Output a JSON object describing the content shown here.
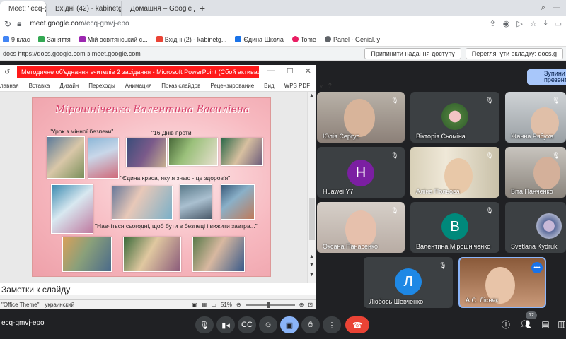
{
  "browser": {
    "tabs": [
      {
        "label": "Meet: \"ecq-gmvj",
        "color": "#00897b"
      },
      {
        "label": "Вхідні (42) - kabinetgeo",
        "color": "#ea4335"
      },
      {
        "label": "Домашня – Google Диск",
        "color": "#fbbc04"
      }
    ],
    "new_tab": "+",
    "url_host": "meet.google.com",
    "url_path": "/ecq-gmvj-epo"
  },
  "bookmarks": [
    {
      "label": "9 клас",
      "color": "#4285f4"
    },
    {
      "label": "Заняття",
      "color": "#34a853"
    },
    {
      "label": "Мій освітянський с...",
      "color": "#9c27b0"
    },
    {
      "label": "Вхідні (2) - kabinetg...",
      "color": "#ea4335"
    },
    {
      "label": "Єдина Школа",
      "color": "#1a73e8"
    },
    {
      "label": "Tome",
      "color": "#e91e63"
    },
    {
      "label": "Panel - Genial.ly",
      "color": "#5f6368"
    }
  ],
  "sharebar": {
    "text": "docs https://docs.google.com з meet.google.com",
    "stop_label": "Припинити надання доступу",
    "view_label": "Переглянути вкладку: docs.g"
  },
  "ppt": {
    "window_title": "Методичне об'єднання вчителів 2 засідання - Microsoft PowerPoint (Сбой активаци...",
    "ribbon_tabs": [
      "лавная",
      "Вставка",
      "Дизайн",
      "Переходы",
      "Анимация",
      "Показ слайдов",
      "Рецензирование",
      "Вид",
      "WPS PDF"
    ],
    "slide": {
      "title": "Мірошніченко Валентина Василівна",
      "caption1": "\"Урок з мінної безпеки\"",
      "caption2": "\"16 Днів проти",
      "caption3": "\"Єдина краса, яку я знаю - це здоров'я\"",
      "caption4": "\"Навчіться сьогодні, щоб бути в безпеці і вижити завтра...\""
    },
    "notes_label": "Заметки к слайду",
    "status_theme": "\"Office Theme\"",
    "status_lang": "украинский",
    "zoom": "51%"
  },
  "presenter_chip": "Зупини презента",
  "participants": [
    {
      "name": "Юлія Сергус"
    },
    {
      "name": "Вікторія Сьоміна"
    },
    {
      "name": "Жанна Рябуха"
    },
    {
      "name": "Huawei Y7",
      "initial": "H",
      "color": "#7b1fa2"
    },
    {
      "name": "Аліна Польова"
    },
    {
      "name": "Віта Панченко"
    },
    {
      "name": "Оксана Панасенко"
    },
    {
      "name": "Валентина Мірошніченко",
      "initial": "В",
      "color": "#00897b"
    },
    {
      "name": "Svetlana Kydruk"
    },
    {
      "name": "Любовь Шевченко",
      "initial": "Л",
      "color": "#1e88e5"
    },
    {
      "name": "А.С. Лісняк"
    }
  ],
  "controls": {
    "meeting_code": "ecq-gmvj-epo",
    "people_count": "12"
  }
}
